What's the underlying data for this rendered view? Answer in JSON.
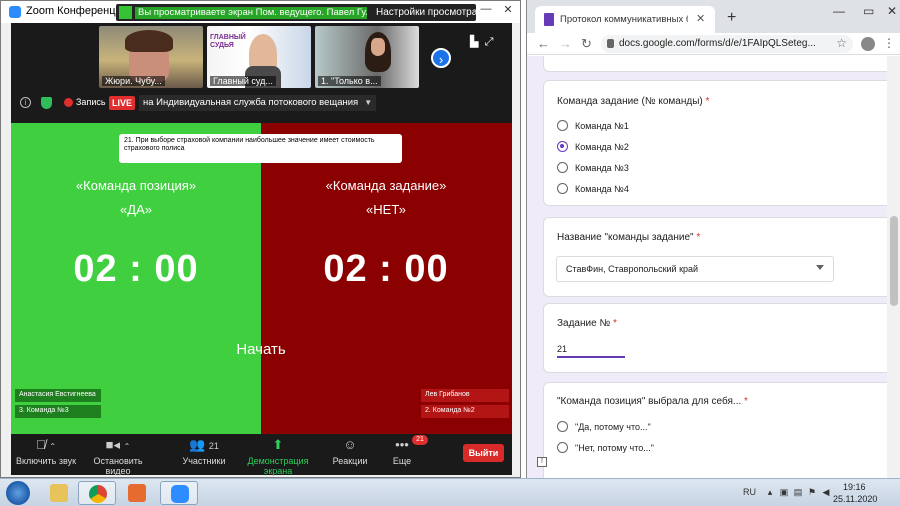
{
  "zoom": {
    "window_title": "Zoom Конференция",
    "share_banner": "Вы просматриваете экран Пом. ведущего. Павел Гуляев",
    "view_options": "Настройки просмотра",
    "participants": [
      {
        "name": "Жюри. Чубу..."
      },
      {
        "name": "Главный суд..."
      },
      {
        "name": "1. \"Только в..."
      }
    ],
    "status": {
      "record_label": "Запись",
      "live_label": "LIVE",
      "stream_label": "на Индивидуальная служба потокового вещания"
    },
    "shared_screen": {
      "question": "21. При выборе страховой компании наибольшее значение имеет стоимость страхового полиса",
      "left_title": "«Команда позиция»",
      "left_answer": "«ДА»",
      "right_title": "«Команда задание»",
      "right_answer": "«НЕТ»",
      "left_timer": "02 : 00",
      "right_timer": "02 : 00",
      "start_label": "Начать",
      "left_tag_name": "Анастасия Евстигнеева",
      "left_tag_team": "3. Команда №3",
      "right_tag_name": "Лев Грибанов",
      "right_tag_team": "2. Команда №2",
      "left_color": "#3fcf3f",
      "right_color": "#8b0000"
    },
    "toolbar": {
      "mute_label": "Включить звук",
      "video_label": "Остановить видео",
      "participants_label": "Участники",
      "participants_count": "21",
      "share_label": "Демонстрация экрана",
      "reactions_label": "Реакции",
      "more_label": "Еще",
      "more_badge": "21",
      "leave_label": "Выйти"
    }
  },
  "chrome": {
    "tab_title": "Протокол коммуникативных бо",
    "url": "docs.google.com/forms/d/e/1FAIpQLSeteg...",
    "form": {
      "q1": {
        "title": "Команда задание (№ команды)",
        "required": "*",
        "options": [
          "Команда №1",
          "Команда №2",
          "Команда №3",
          "Команда №4"
        ],
        "selected_index": 1
      },
      "q2": {
        "title": "Название \"команды задание\"",
        "required": "*",
        "value": "СтавФин, Ставропольский край"
      },
      "q3": {
        "title": "Задание №",
        "required": "*",
        "value": "21"
      },
      "q4": {
        "title": "\"Команда позиция\" выбрала для себя...",
        "required": "*",
        "options": [
          "\"Да, потому что...\"",
          "\"Нет, потому что...\""
        ]
      }
    }
  },
  "taskbar": {
    "language": "RU",
    "time": "19:16",
    "date": "25.11.2020"
  }
}
